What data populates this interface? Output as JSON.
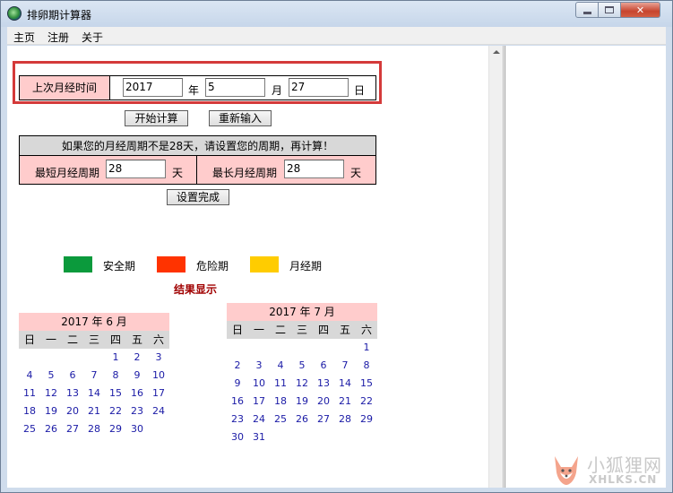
{
  "window": {
    "title": "排卵期计算器",
    "controls": {
      "minimize_icon": "minimize-icon",
      "maximize_icon": "maximize-icon",
      "close_glyph": "✕"
    }
  },
  "menu": {
    "items": [
      "主页",
      "注册",
      "关于"
    ]
  },
  "last_period": {
    "label": "上次月经时间",
    "year_value": "2017",
    "year_unit": "年",
    "month_value": "5",
    "month_unit": "月",
    "day_value": "27",
    "day_unit": "日"
  },
  "actions": {
    "start_label": "开始计算",
    "reset_label": "重新输入"
  },
  "cycle": {
    "notice": "如果您的月经周期不是28天，请设置您的周期，再计算！",
    "shortest_label": "最短月经周期",
    "shortest_value": "28",
    "longest_label": "最长月经周期",
    "longest_value": "28",
    "unit": "天",
    "done_label": "设置完成"
  },
  "legend": [
    {
      "label": "安全期",
      "color": "#0b9a3c"
    },
    {
      "label": "危险期",
      "color": "#ff3300"
    },
    {
      "label": "月经期",
      "color": "#ffcc00"
    }
  ],
  "result_title": "结果显示",
  "calendars": [
    {
      "title": "2017 年 6 月",
      "weekdays": [
        "日",
        "一",
        "二",
        "三",
        "四",
        "五",
        "六"
      ],
      "leading_blanks": 4,
      "days": [
        "1",
        "2",
        "3",
        "4",
        "5",
        "6",
        "7",
        "8",
        "9",
        "10",
        "11",
        "12",
        "13",
        "14",
        "15",
        "16",
        "17",
        "18",
        "19",
        "20",
        "21",
        "22",
        "23",
        "24",
        "25",
        "26",
        "27",
        "28",
        "29",
        "30"
      ]
    },
    {
      "title": "2017 年 7 月",
      "weekdays": [
        "日",
        "一",
        "二",
        "三",
        "四",
        "五",
        "六"
      ],
      "leading_blanks": 6,
      "days": [
        "1",
        "2",
        "3",
        "4",
        "5",
        "6",
        "7",
        "8",
        "9",
        "10",
        "11",
        "12",
        "13",
        "14",
        "15",
        "16",
        "17",
        "18",
        "19",
        "20",
        "21",
        "22",
        "23",
        "24",
        "25",
        "26",
        "27",
        "28",
        "29",
        "30",
        "31"
      ]
    }
  ],
  "watermark": {
    "cn": "小狐狸网",
    "en": "XHLKS.CN"
  }
}
